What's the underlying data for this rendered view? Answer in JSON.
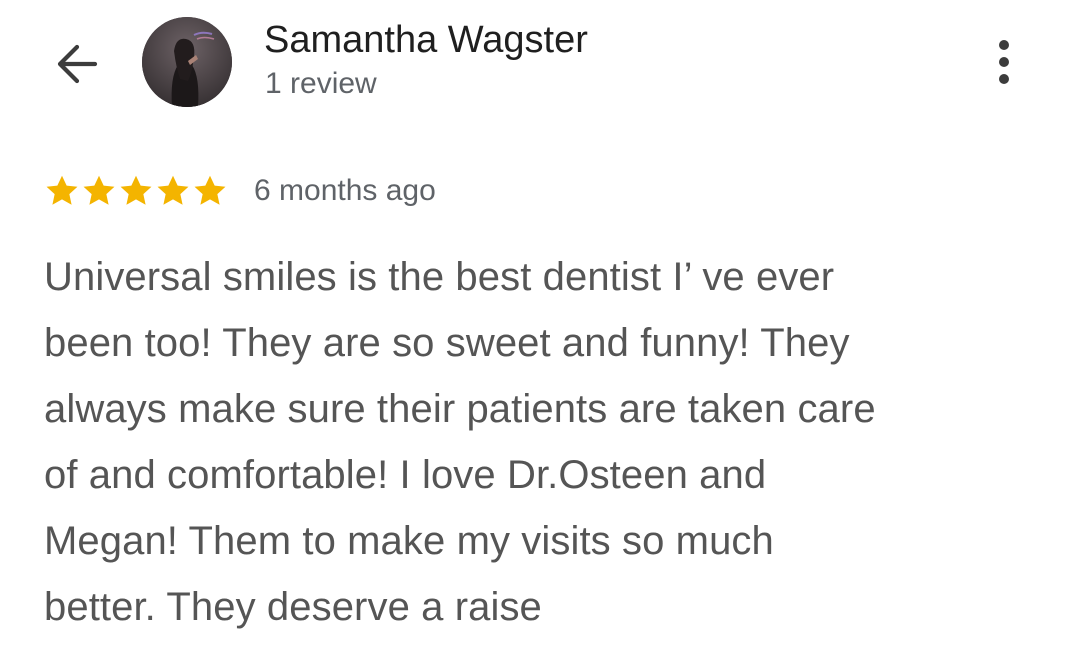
{
  "header": {
    "back_icon": "arrow-back-icon",
    "reviewer_name": "Samantha Wagster",
    "review_count": "1 review",
    "more_icon": "more-vert-icon"
  },
  "review": {
    "rating": 5,
    "max_rating": 5,
    "star_color": "#f4b400",
    "date": "6 months ago",
    "text_lines": [
      "Universal smiles is the best dentist I’ ve ever",
      "been too! They are so sweet and funny! They",
      "always make sure their patients are taken care",
      "of and comfortable! I love Dr.Osteen and",
      "Megan! Them to make my visits so much",
      "better. They deserve a raise"
    ]
  }
}
